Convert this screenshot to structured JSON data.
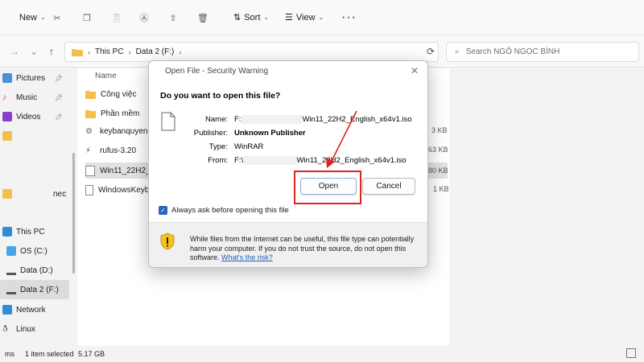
{
  "toolbar": {
    "new_label": "New",
    "sort_label": "Sort",
    "view_label": "View"
  },
  "address": {
    "crumbs": [
      "This PC",
      "Data 2 (F:)"
    ]
  },
  "search": {
    "placeholder": "Search NGÔ NGỌC BÌNH"
  },
  "sidebar": {
    "items": [
      {
        "label": "Pictures"
      },
      {
        "label": "Music"
      },
      {
        "label": "Videos"
      },
      {
        "label": "This PC"
      },
      {
        "label": "OS (C:)"
      },
      {
        "label": "Data (D:)"
      },
      {
        "label": "Data 2 (F:)"
      },
      {
        "label": "Network"
      },
      {
        "label": "Linux"
      }
    ],
    "partial": "nec"
  },
  "filelist": {
    "column_name": "Name",
    "rows": [
      {
        "name": "Công việc",
        "size": ""
      },
      {
        "name": "Phần mềm",
        "size": ""
      },
      {
        "name": "keybanquyen",
        "size": "3 KB"
      },
      {
        "name": "rufus-3.20",
        "size": "63 KB"
      },
      {
        "name": "Win11_22H2_E",
        "size": "80 KB"
      },
      {
        "name": "WindowsKeyba",
        "size": "1 KB"
      }
    ]
  },
  "status": {
    "count": "1 item selected",
    "size": "5.17 GB"
  },
  "dialog": {
    "title": "Open File - Security Warning",
    "question": "Do you want to open this file?",
    "name_label": "Name:",
    "name_value": "Win11_22H2_English_x64v1.iso",
    "publisher_label": "Publisher:",
    "publisher_value": "Unknown Publisher",
    "type_label": "Type:",
    "type_value": "WinRAR",
    "from_label": "From:",
    "from_value": "Win11_22H2_English_x64v1.iso",
    "open_label": "Open",
    "cancel_label": "Cancel",
    "checkbox_label": "Always ask before opening this file",
    "warning_text": "While files from the Internet can be useful, this file type can potentially harm your computer. If you do not trust the source, do not open this software.",
    "risk_link": "What's the risk?"
  },
  "colors": {
    "highlight": "#e0221f",
    "accent": "#2566b8",
    "folder": "#f2c04a"
  }
}
